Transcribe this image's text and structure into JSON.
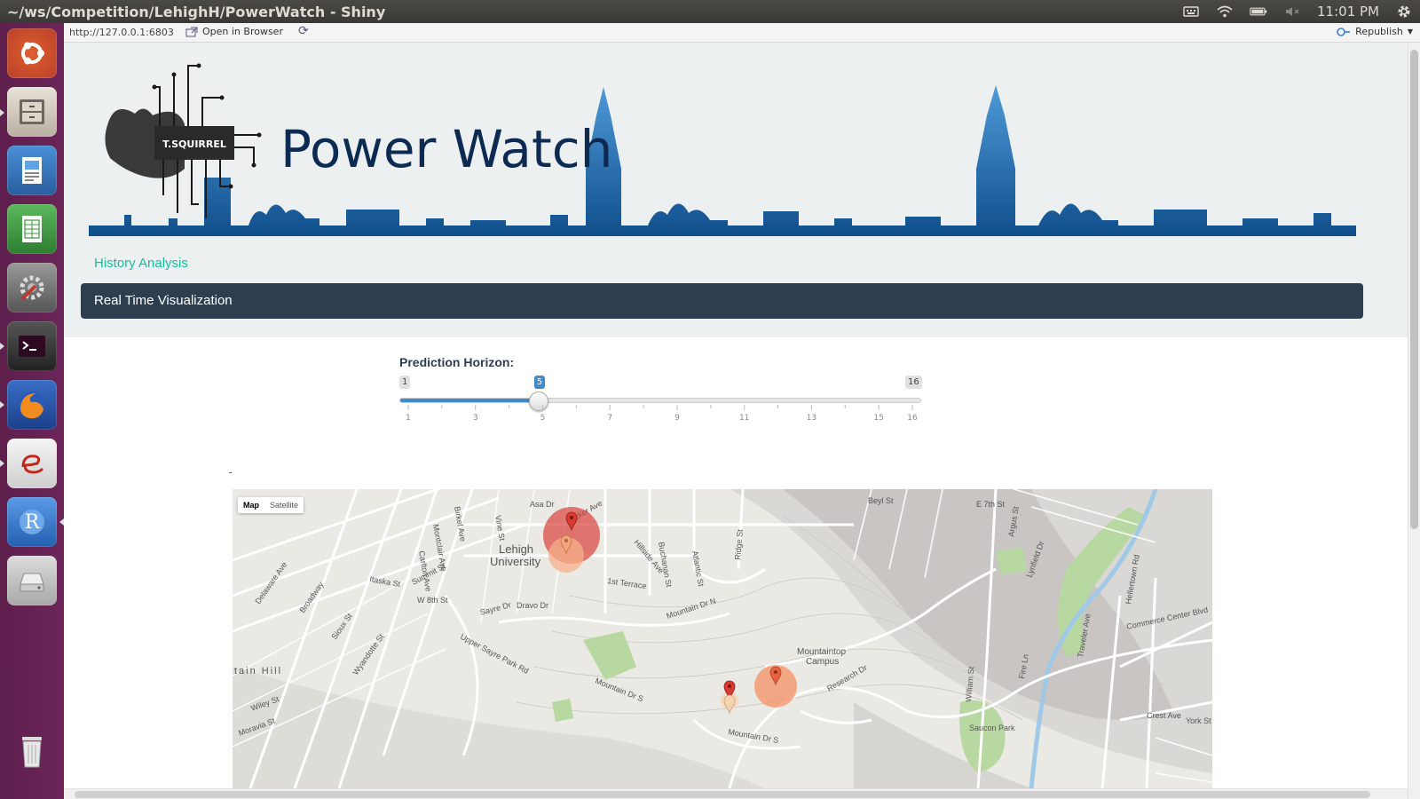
{
  "window": {
    "title": "~/ws/Competition/LehighH/PowerWatch - Shiny"
  },
  "tray": {
    "time": "11:01 PM"
  },
  "viewer": {
    "url": "http://127.0.0.1:6803",
    "open_browser_label": "Open in Browser",
    "republish_label": "Republish"
  },
  "header": {
    "logo_text": "T.SQUIRREL",
    "app_title": "Power Watch"
  },
  "nav": {
    "history": "History Analysis",
    "realtime": "Real Time Visualization"
  },
  "slider": {
    "label": "Prediction Horizon:",
    "min": 1,
    "max": 16,
    "value": 5,
    "min_label": "1",
    "max_label": "16",
    "value_label": "5",
    "tick_labels": [
      "1",
      "3",
      "5",
      "7",
      "9",
      "11",
      "13",
      "15",
      "16"
    ]
  },
  "map": {
    "type_map": "Map",
    "type_satellite": "Satellite",
    "campus_labels": [
      "Lehigh",
      "University",
      "Mountaintop",
      "Campus",
      "Saucon Park",
      "tain Hill"
    ],
    "street_labels": [
      "Asa Dr",
      "Packer Ave",
      "Buchanan St",
      "Atlantic St",
      "Hillside Ave",
      "1st Terrace",
      "Mountain Dr N",
      "Mountain Dr S",
      "Summit St",
      "W 8th St",
      "Sayre Dr",
      "Dravo Dr",
      "Upper Sayre Park Rd",
      "Broadway",
      "Itaska St",
      "Research Dr",
      "William St",
      "Traveler Ave",
      "Commerce Center Blvd",
      "Hellertown Rd",
      "Crest Ave",
      "York St",
      "Wiley St",
      "Moravia St",
      "E 7th St",
      "Beyl St",
      "Argus St",
      "Lynfield Dr",
      "Fire Ln",
      "Ridge St",
      "Delaware Ave",
      "Wyandotte St",
      "Vine St",
      "Montclair Ave",
      "Birkel Ave",
      "Carlton Ave",
      "Sioux St"
    ]
  },
  "colors": {
    "nav_bar": "#2c3e50",
    "nav_link": "#18bc9c",
    "slider": "#428bca",
    "launcher": "#6b2558"
  }
}
